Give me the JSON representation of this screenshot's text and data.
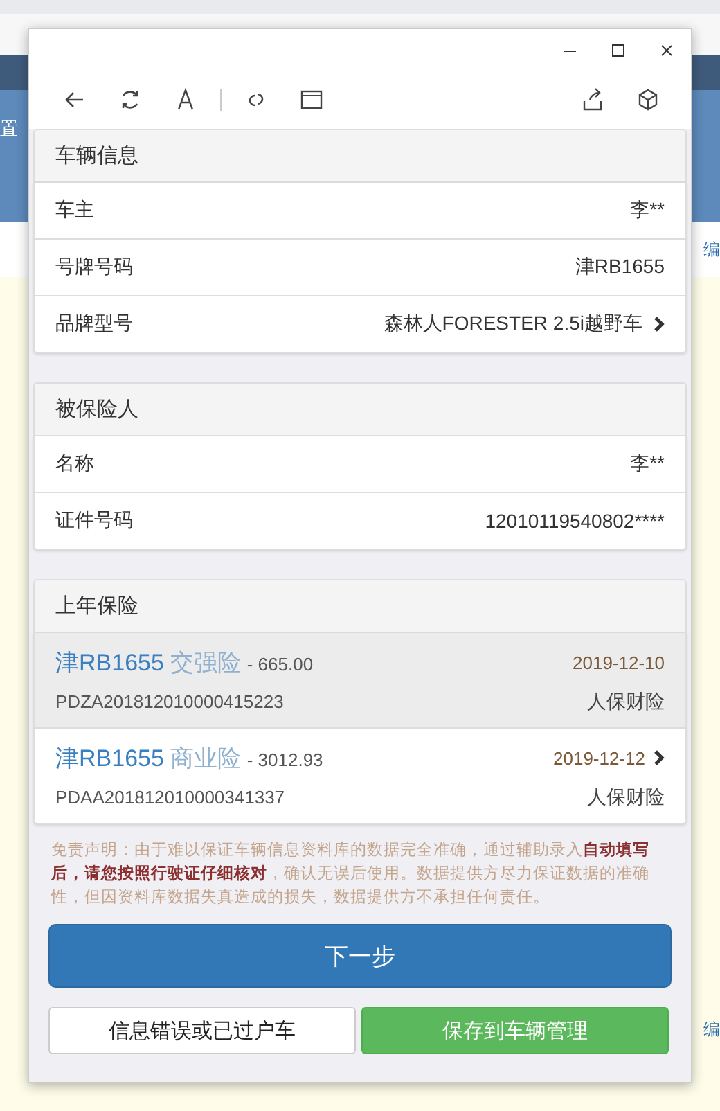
{
  "background_page": {
    "left_text": "置",
    "right_texts": [
      "编",
      "编"
    ]
  },
  "sections": [
    {
      "title": "车辆信息",
      "rows": [
        {
          "label": "车主",
          "value": "李**",
          "kind": "plain"
        },
        {
          "label": "号牌号码",
          "value": "津RB1655",
          "kind": "plain"
        },
        {
          "label": "品牌型号",
          "value": "森林人FORESTER 2.5i越野车",
          "kind": "link"
        }
      ]
    },
    {
      "title": "被保险人",
      "rows": [
        {
          "label": "名称",
          "value": "李**",
          "kind": "plain"
        },
        {
          "label": "证件号码",
          "value": "12010119540802****",
          "kind": "plain"
        }
      ]
    }
  ],
  "previous_insurance": {
    "title": "上年保险",
    "policies": [
      {
        "plate": "津RB1655",
        "type": "交强险",
        "amount": "- 665.00",
        "date": "2019-12-10",
        "policy_no": "PDZA201812010000415223",
        "insurer": "人保财险",
        "highlighted": true,
        "kind": "plain"
      },
      {
        "plate": "津RB1655",
        "type": "商业险",
        "amount": "- 3012.93",
        "date": "2019-12-12",
        "policy_no": "PDAA201812010000341337",
        "insurer": "人保财险",
        "highlighted": false,
        "kind": "link"
      }
    ]
  },
  "disclaimer": "免责声明：由于难以保证车辆信息资料库的数据完全准确，通过辅助录入**自动填写后，请您按照行驶证仔细核对**，确认无误后使用。数据提供方尽力保证数据的准确性，但因资料库数据失真造成的损失，数据提供方不承担任何责任。",
  "buttons": {
    "primary": "下一步",
    "secondary": "信息错误或已过户车",
    "success": "保存到车辆管理"
  }
}
